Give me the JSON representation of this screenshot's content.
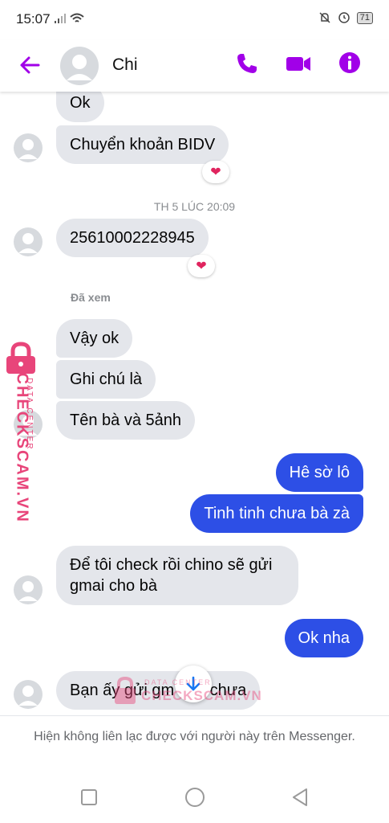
{
  "status_bar": {
    "time": "15:07",
    "battery": "71"
  },
  "header": {
    "contact_name": "Chi",
    "back_icon": "arrow-left-icon",
    "call_icon": "phone-icon",
    "video_icon": "video-camera-icon",
    "info_icon": "info-icon",
    "accent": "#a100e8"
  },
  "messages": [
    {
      "dir": "in",
      "text": "Ok"
    },
    {
      "dir": "in",
      "text": "Chuyển khoản BIDV",
      "reaction": "❤"
    },
    {
      "dir": "in",
      "text": "25610002228945",
      "reaction": "❤"
    },
    {
      "dir": "in",
      "text": "Vậy ok"
    },
    {
      "dir": "in",
      "text": "Ghi chú là"
    },
    {
      "dir": "in",
      "text": "Tên bà và 5ảnh"
    },
    {
      "dir": "out",
      "text": "Hê sờ lô"
    },
    {
      "dir": "out",
      "text": "Tinh tinh chưa bà zà"
    },
    {
      "dir": "in",
      "text": "Để tôi check rồi chino sẽ gửi gmai cho bà"
    },
    {
      "dir": "out",
      "text": "Ok nha"
    },
    {
      "dir": "in",
      "text": "Bạn ấy gửi gm   o bf chưa"
    }
  ],
  "timestamp": "TH 5 LÚC 20:09",
  "seen_label": "Đã xem",
  "watermark": {
    "brand": "CHECKSCAM.VN",
    "tag": "DATA CENTER"
  },
  "notice": "Hiện không liên lạc được với người này trên Messenger.",
  "colors": {
    "outgoing": "#2d4fe6",
    "incoming": "#e4e6eb",
    "watermark": "#e8457a"
  }
}
